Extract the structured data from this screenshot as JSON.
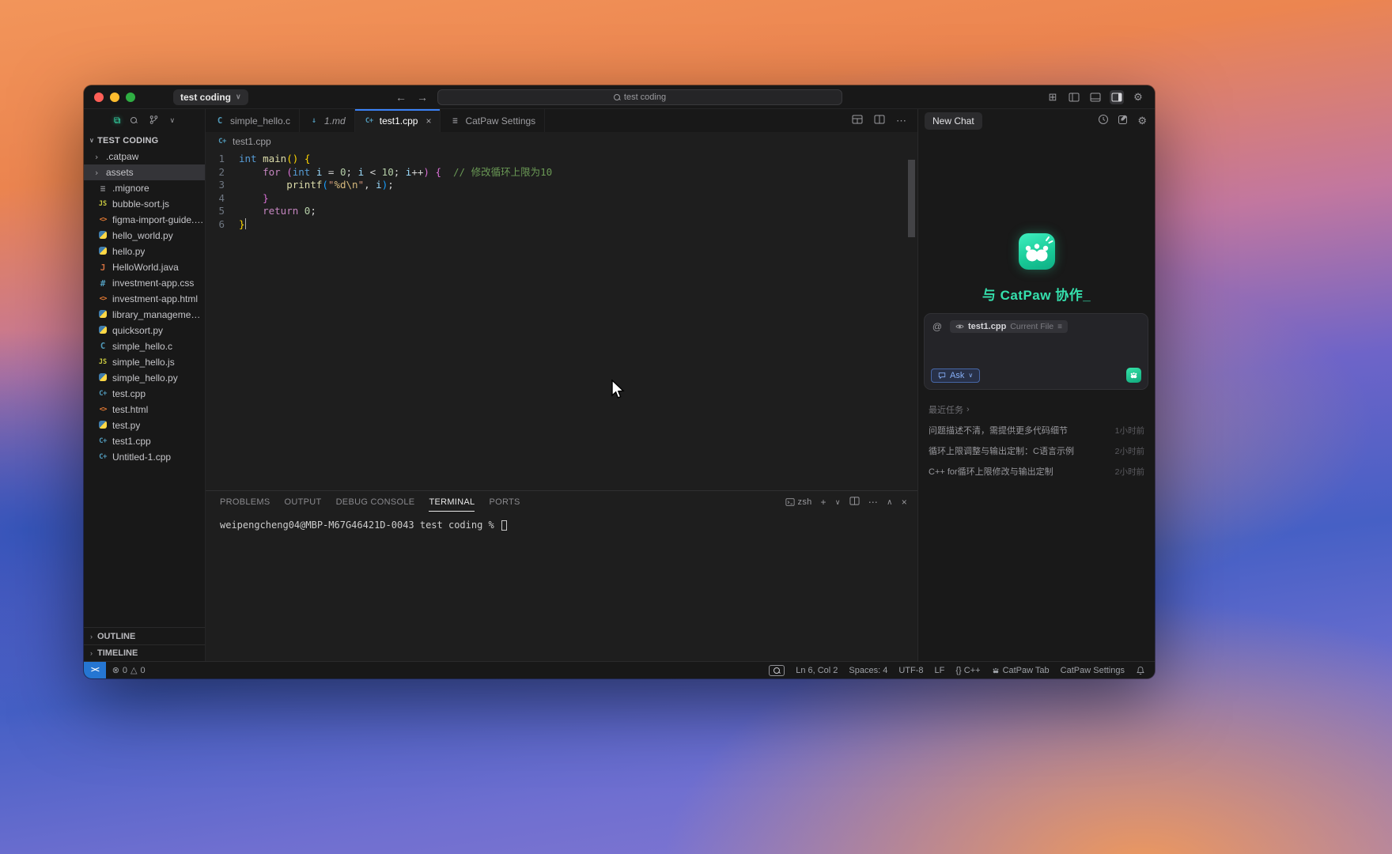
{
  "titlebar": {
    "project": "test coding",
    "search_text": "test coding",
    "back": "←",
    "forward": "→"
  },
  "sidebar": {
    "section": "TEST CODING",
    "items": [
      {
        "name": ".catpaw",
        "icon": "folder",
        "type": "folder"
      },
      {
        "name": "assets",
        "icon": "folder",
        "type": "folder",
        "selected": true
      },
      {
        "name": ".mignore",
        "icon": "list"
      },
      {
        "name": "bubble-sort.js",
        "icon": "js"
      },
      {
        "name": "figma-import-guide.h...",
        "icon": "html"
      },
      {
        "name": "hello_world.py",
        "icon": "py"
      },
      {
        "name": "hello.py",
        "icon": "py"
      },
      {
        "name": "HelloWorld.java",
        "icon": "java"
      },
      {
        "name": "investment-app.css",
        "icon": "css"
      },
      {
        "name": "investment-app.html",
        "icon": "html"
      },
      {
        "name": "library_management...",
        "icon": "py"
      },
      {
        "name": "quicksort.py",
        "icon": "py"
      },
      {
        "name": "simple_hello.c",
        "icon": "c"
      },
      {
        "name": "simple_hello.js",
        "icon": "js"
      },
      {
        "name": "simple_hello.py",
        "icon": "py"
      },
      {
        "name": "test.cpp",
        "icon": "cpp"
      },
      {
        "name": "test.html",
        "icon": "html"
      },
      {
        "name": "test.py",
        "icon": "py"
      },
      {
        "name": "test1.cpp",
        "icon": "cpp"
      },
      {
        "name": "Untitled-1.cpp",
        "icon": "cpp"
      }
    ],
    "outline": "OUTLINE",
    "timeline": "TIMELINE"
  },
  "tabs": [
    {
      "label": "simple_hello.c",
      "icon": "c"
    },
    {
      "label": "1.md",
      "icon": "md",
      "italic": true
    },
    {
      "label": "test1.cpp",
      "icon": "cpp",
      "active": true,
      "close": "×"
    },
    {
      "label": "CatPaw Settings",
      "icon": "settings"
    }
  ],
  "breadcrumb": {
    "file": "test1.cpp"
  },
  "editor": {
    "lines": [
      {
        "n": "1",
        "tokens": [
          [
            "kw",
            "int"
          ],
          [
            "pl",
            " "
          ],
          [
            "fn",
            "main"
          ],
          [
            "bry",
            "()"
          ],
          [
            "pl",
            " "
          ],
          [
            "bry",
            "{"
          ]
        ]
      },
      {
        "n": "2",
        "tokens": [
          [
            "pl",
            "    "
          ],
          [
            "ctl",
            "for"
          ],
          [
            "pl",
            " "
          ],
          [
            "brp",
            "("
          ],
          [
            "kw",
            "int"
          ],
          [
            "pl",
            " "
          ],
          [
            "var",
            "i"
          ],
          [
            "pl",
            " = "
          ],
          [
            "num",
            "0"
          ],
          [
            "pl",
            "; "
          ],
          [
            "var",
            "i"
          ],
          [
            "pl",
            " < "
          ],
          [
            "num",
            "10"
          ],
          [
            "pl",
            "; "
          ],
          [
            "var",
            "i"
          ],
          [
            "pl",
            "++"
          ],
          [
            "brp",
            ")"
          ],
          [
            "pl",
            " "
          ],
          [
            "brp",
            "{"
          ],
          [
            "cm",
            "  // 修改循环上限为10"
          ]
        ]
      },
      {
        "n": "3",
        "tokens": [
          [
            "pl",
            "        "
          ],
          [
            "fn",
            "printf"
          ],
          [
            "brb",
            "("
          ],
          [
            "str",
            "\""
          ],
          [
            "esc",
            "%d"
          ],
          [
            "esc",
            "\\n"
          ],
          [
            "str",
            "\""
          ],
          [
            "pl",
            ", "
          ],
          [
            "var",
            "i"
          ],
          [
            "brb",
            ")"
          ],
          [
            "pl",
            ";"
          ]
        ]
      },
      {
        "n": "4",
        "tokens": [
          [
            "pl",
            "    "
          ],
          [
            "brp",
            "}"
          ]
        ]
      },
      {
        "n": "5",
        "tokens": [
          [
            "pl",
            "    "
          ],
          [
            "ctl",
            "return"
          ],
          [
            "pl",
            " "
          ],
          [
            "num",
            "0"
          ],
          [
            "pl",
            ";"
          ]
        ]
      },
      {
        "n": "6",
        "tokens": [
          [
            "bry",
            "}"
          ]
        ],
        "cursor": true
      }
    ]
  },
  "panel": {
    "tabs": [
      {
        "label": "PROBLEMS"
      },
      {
        "label": "OUTPUT"
      },
      {
        "label": "DEBUG CONSOLE"
      },
      {
        "label": "TERMINAL",
        "active": true
      },
      {
        "label": "PORTS"
      }
    ],
    "shell": "zsh",
    "prompt": "weipengcheng04@MBP-M67G46421D-0043 test coding % "
  },
  "catpaw": {
    "new_chat": "New Chat",
    "title": "与 CatPaw 协作_",
    "context_file": "test1.cpp",
    "context_label": "Current File",
    "at": "@",
    "ask": "Ask",
    "tasks_header": "最近任务",
    "tasks": [
      {
        "text": "问题描述不清，需提供更多代码细节",
        "time": "1小时前"
      },
      {
        "text": "循环上限调整与输出定制：C语言示例",
        "time": "2小时前"
      },
      {
        "text": "C++ for循环上限修改与输出定制",
        "time": "2小时前"
      }
    ]
  },
  "statusbar": {
    "remote": "><",
    "errors": "0",
    "warnings": "0",
    "ln_col": "Ln 6, Col 2",
    "spaces": "Spaces: 4",
    "encoding": "UTF-8",
    "eol": "LF",
    "lang": "{} C++",
    "catpaw_tab": "CatPaw Tab",
    "catpaw_settings": "CatPaw Settings"
  }
}
